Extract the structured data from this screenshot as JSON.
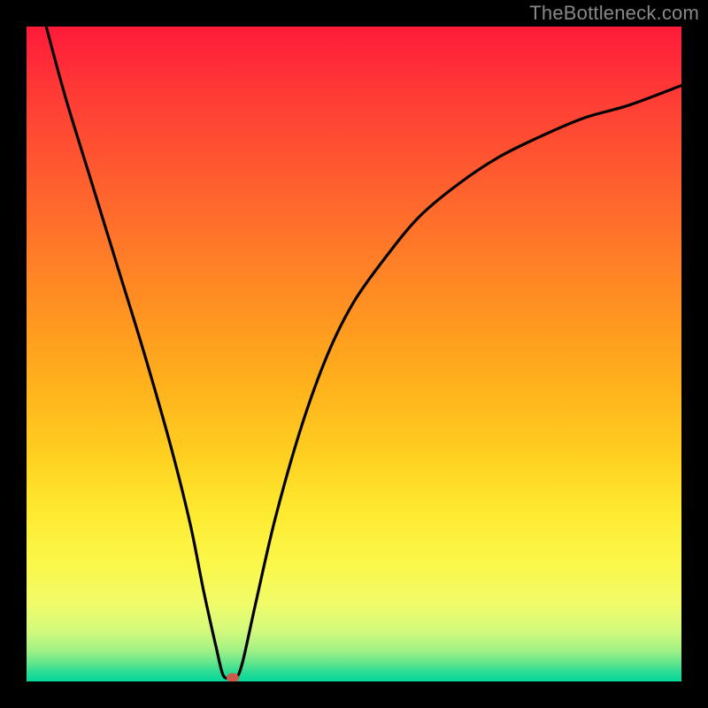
{
  "watermark": "TheBottleneck.com",
  "chart_data": {
    "type": "line",
    "title": "",
    "xlabel": "",
    "ylabel": "",
    "xlim": [
      0,
      100
    ],
    "ylim": [
      0,
      100
    ],
    "grid": false,
    "legend": false,
    "series": [
      {
        "name": "curve",
        "x": [
          3,
          6,
          10,
          14,
          18,
          22,
          25,
          27,
          29,
          30,
          31,
          32,
          33,
          35,
          38,
          42,
          46,
          50,
          55,
          60,
          66,
          72,
          78,
          85,
          92,
          100
        ],
        "y": [
          100,
          89,
          76,
          63,
          50,
          36,
          24,
          14,
          5,
          1,
          0.5,
          0.5,
          3,
          12,
          25,
          39,
          50,
          58,
          65,
          71,
          76,
          80,
          83,
          86,
          88,
          91
        ]
      }
    ],
    "annotations": [
      {
        "type": "marker",
        "x": 31.5,
        "y": 0.5,
        "color": "#cc5a4a"
      }
    ],
    "background_gradient": {
      "direction": "vertical",
      "stops": [
        {
          "pos": 0.0,
          "color": "#ff1a3a"
        },
        {
          "pos": 0.55,
          "color": "#ffb21c"
        },
        {
          "pos": 0.82,
          "color": "#fbf74a"
        },
        {
          "pos": 1.0,
          "color": "#06d79a"
        }
      ]
    }
  },
  "colors": {
    "frame": "#000000",
    "curve": "#000000",
    "marker": "#cc5a4a",
    "watermark": "#888888"
  }
}
